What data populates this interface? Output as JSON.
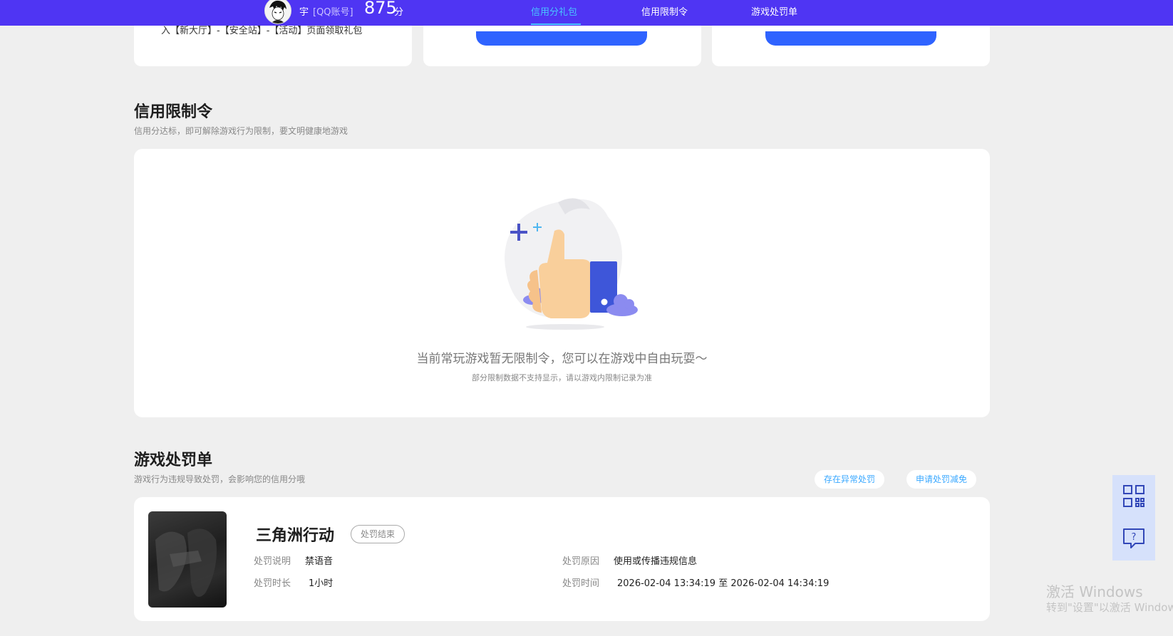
{
  "header": {
    "user_name": "宇",
    "account_tag": "[QQ账号]",
    "score": "875",
    "score_unit": "分",
    "tabs": [
      {
        "label": "信用分礼包",
        "active": true
      },
      {
        "label": "信用限制令",
        "active": false
      },
      {
        "label": "游戏处罚单",
        "active": false
      }
    ]
  },
  "top_cards": {
    "card1_text": "入【新大厅】-【安全站】-【活动】页面领取礼包"
  },
  "restriction": {
    "title": "信用限制令",
    "subtitle": "信用分达标，即可解除游戏行为限制，要文明健康地游戏",
    "empty_main": "当前常玩游戏暂无限制令，您可以在游戏中自由玩耍～",
    "empty_sub": "部分限制数据不支持显示，请以游戏内限制记录为准"
  },
  "penalty": {
    "title": "游戏处罚单",
    "subtitle": "游戏行为违规导致处罚，会影响您的信用分哦",
    "btn_abnormal": "存在异常处罚",
    "btn_appeal": "申请处罚减免",
    "record": {
      "game": "三角洲行动",
      "status": "处罚结束",
      "desc_label": "处罚说明",
      "desc_value": "禁语音",
      "duration_label": "处罚时长",
      "duration_value": "1小时",
      "reason_label": "处罚原因",
      "reason_value": "使用或传播违规信息",
      "time_label": "处罚时间",
      "time_value": "2026-02-04 13:34:19 至 2026-02-04 14:34:19"
    }
  },
  "side_widget": [
    "qr-code-icon",
    "question-chat-icon"
  ],
  "watermark": {
    "line1": "激活 Windows",
    "line2": "转到\"设置\"以激活 Windows"
  },
  "colors": {
    "topbar": "#4f35f3",
    "active_tab": "#49c5ff",
    "link_blue": "#3aa8ff"
  }
}
